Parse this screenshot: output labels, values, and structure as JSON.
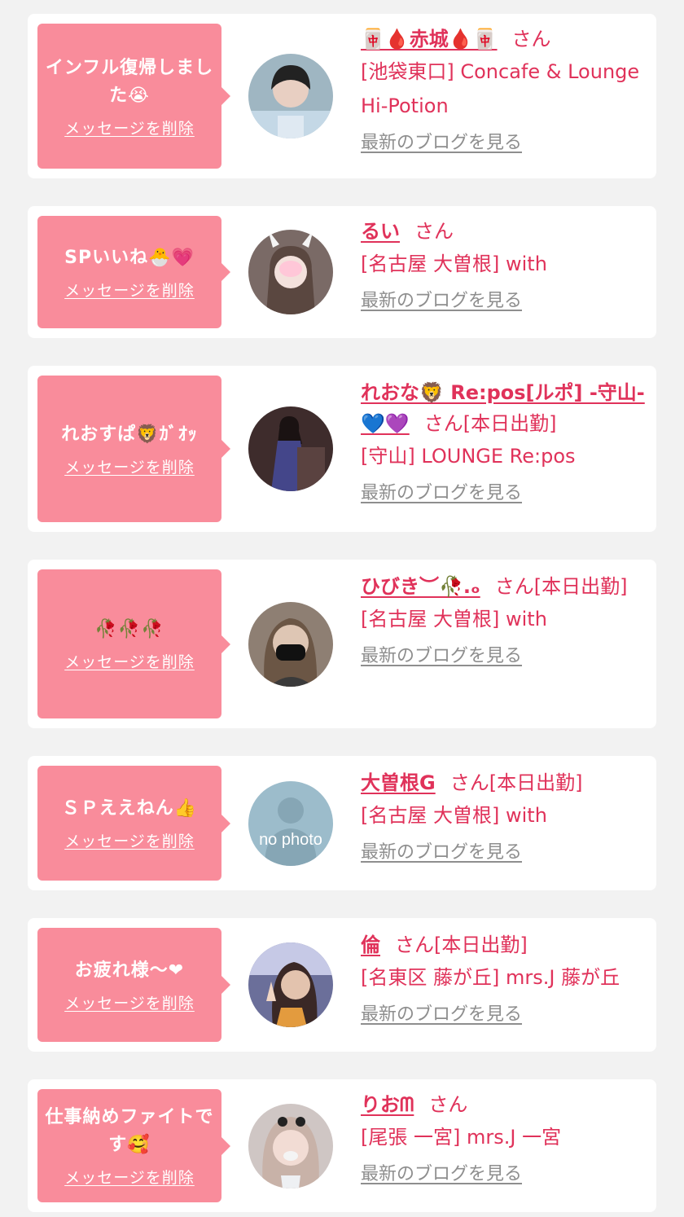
{
  "colors": {
    "page_bg": "#f2f2f2",
    "card_bg": "#ffffff",
    "bubble_bg": "#f98c9b",
    "accent": "#e0325a",
    "link_gray": "#8e8e8e"
  },
  "entries": [
    {
      "message": "インフル復帰しました😭",
      "delete_label": "メッセージを削除",
      "name": "🀄🩸赤城🩸🀄",
      "honorific": "さん",
      "status": "",
      "shop": "[池袋東口] Concafe & Lounge Hi-Potion",
      "blog_label": "最新のブログを見る",
      "avatar_icon": "profile-photo"
    },
    {
      "message": "SPいいね🐣💗",
      "delete_label": "メッセージを削除",
      "name": "るい",
      "honorific": "さん",
      "status": "",
      "shop": "[名古屋 大曽根] with",
      "blog_label": "最新のブログを見る",
      "avatar_icon": "profile-photo"
    },
    {
      "message": "れおすぱ🦁ｶﾞｵｯ",
      "delete_label": "メッセージを削除",
      "name": "れおな🦁 Re:pos[ルポ] -守山-💙💜",
      "honorific": "さん",
      "status": "[本日出勤]",
      "shop": "[守山] LOUNGE Re:pos",
      "blog_label": "最新のブログを見る",
      "avatar_icon": "profile-photo"
    },
    {
      "message": "🥀🥀🥀",
      "delete_label": "メッセージを削除",
      "name": "ひびき︶🥀.ₒ",
      "honorific": "さん",
      "status": "[本日出勤]",
      "shop": "[名古屋 大曽根] with",
      "blog_label": "最新のブログを見る",
      "avatar_icon": "profile-photo"
    },
    {
      "message": "ＳＰええねん👍",
      "delete_label": "メッセージを削除",
      "name": "大曽根G",
      "honorific": "さん",
      "status": "[本日出勤]",
      "shop": "[名古屋 大曽根] with",
      "blog_label": "最新のブログを見る",
      "avatar_icon": "no-photo-placeholder",
      "avatar_text": "no photo"
    },
    {
      "message": "お疲れ様〜❤",
      "delete_label": "メッセージを削除",
      "name": "倫",
      "honorific": "さん",
      "status": "[本日出勤]",
      "shop": "[名東区 藤が丘] mrs.J 藤が丘",
      "blog_label": "最新のブログを見る",
      "avatar_icon": "profile-photo"
    },
    {
      "message": "仕事納めファイトです🥰",
      "delete_label": "メッセージを削除",
      "name": "りおᗰ",
      "honorific": "さん",
      "status": "",
      "shop": "[尾張 一宮] mrs.J 一宮",
      "blog_label": "最新のブログを見る",
      "avatar_icon": "profile-photo"
    }
  ]
}
